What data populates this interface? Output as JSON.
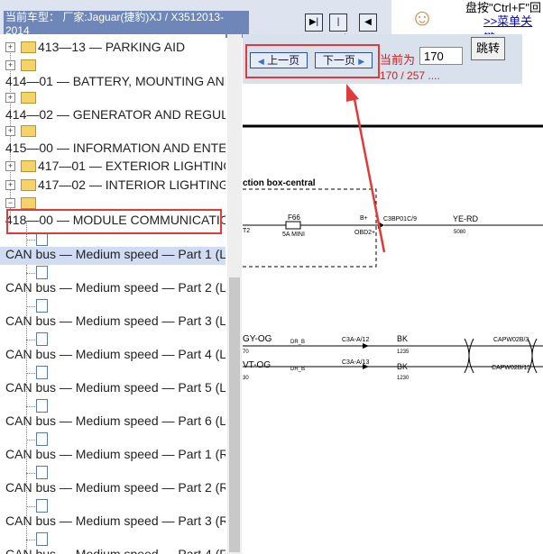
{
  "header": {
    "car_model": "当前车型： 厂家:Jaguar(捷豹)XJ / X3512013-2014"
  },
  "nav": {
    "btn1": "▶|",
    "btn2": "|◀▶|",
    "btn3": "◀"
  },
  "help": {
    "text": "盘按\"Ctrl+F\"回",
    "link": ">>菜单关键"
  },
  "tree": {
    "items": [
      {
        "label": "413—13 — PARKING AID"
      },
      {
        "label": "414—01 — BATTERY, MOUNTING AND"
      },
      {
        "label": "414—02 — GENERATOR AND REGULA"
      },
      {
        "label": "415—00 — INFORMATION AND ENTE"
      },
      {
        "label": "417—01 — EXTERIOR LIGHTING"
      },
      {
        "label": "417—02 — INTERIOR LIGHTING"
      },
      {
        "label": "418—00 — MODULE COMMUNICATIO"
      },
      {
        "label": "CAN bus — Medium speed — Part 1 (L"
      },
      {
        "label": "CAN bus — Medium speed — Part 2 (L"
      },
      {
        "label": "CAN bus — Medium speed — Part 3 (L"
      },
      {
        "label": "CAN bus — Medium speed — Part 4 (L"
      },
      {
        "label": "CAN bus — Medium speed — Part 5 (L"
      },
      {
        "label": "CAN bus — Medium speed — Part 6 (L"
      },
      {
        "label": "CAN bus — Medium speed — Part 1 (R"
      },
      {
        "label": "CAN bus — Medium speed — Part 2 (R"
      },
      {
        "label": "CAN bus — Medium speed — Part 3 (R"
      },
      {
        "label": "CAN bus — Medium speed — Part 4 (R"
      }
    ]
  },
  "pager": {
    "prev_label": "上一页",
    "next_label": "下一页",
    "current_label": "当前为",
    "current_page": "170",
    "page_count": "170 / 257 ....",
    "jump_label": "跳转"
  },
  "diagram": {
    "junction": "ction box-central",
    "fuse_name": "F66",
    "fuse_rating": "5A MINI",
    "fuse_left": "T2",
    "bplus": "B+",
    "obd": "OBD2+",
    "connector": "C3BP01C/9",
    "wire_color": "YE-RD",
    "wire_num": "5080",
    "row2_left": "GY-OG",
    "row2_left_num": "70",
    "row2_dr": "DR_B",
    "row2_conn": "C3A-A/12",
    "row2_color": "BK",
    "row2_num": "1235",
    "row2_right": "CAPW02B/3",
    "row3_left": "VT-OG",
    "row3_left_num": "30",
    "row3_dr": "DR_B",
    "row3_conn": "C3A-A/13",
    "row3_color": "BK",
    "row3_num": "1230",
    "row3_right": "CAPW02B/15"
  },
  "colors": {
    "highlight": "#e03a3a",
    "selected": "#cfdcf2"
  }
}
